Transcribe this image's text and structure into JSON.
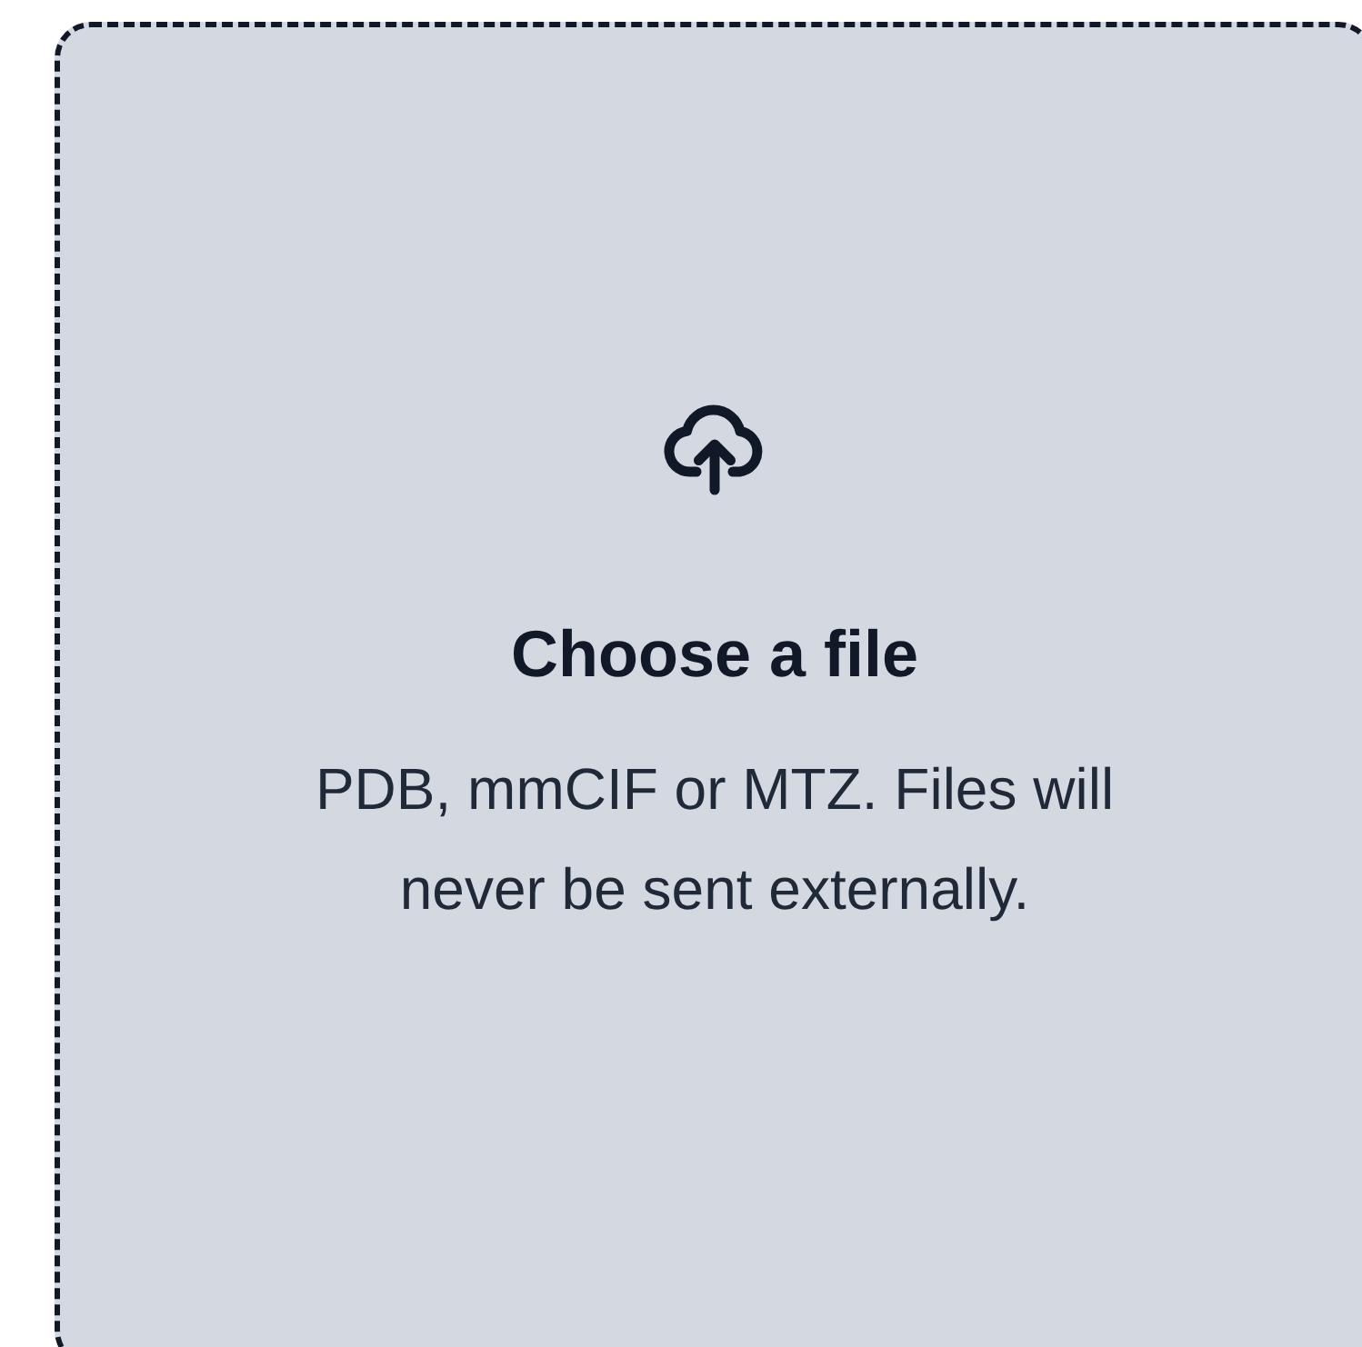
{
  "dropzone": {
    "title": "Choose a file",
    "description": "PDB, mmCIF or MTZ. Files will never be sent externally."
  }
}
